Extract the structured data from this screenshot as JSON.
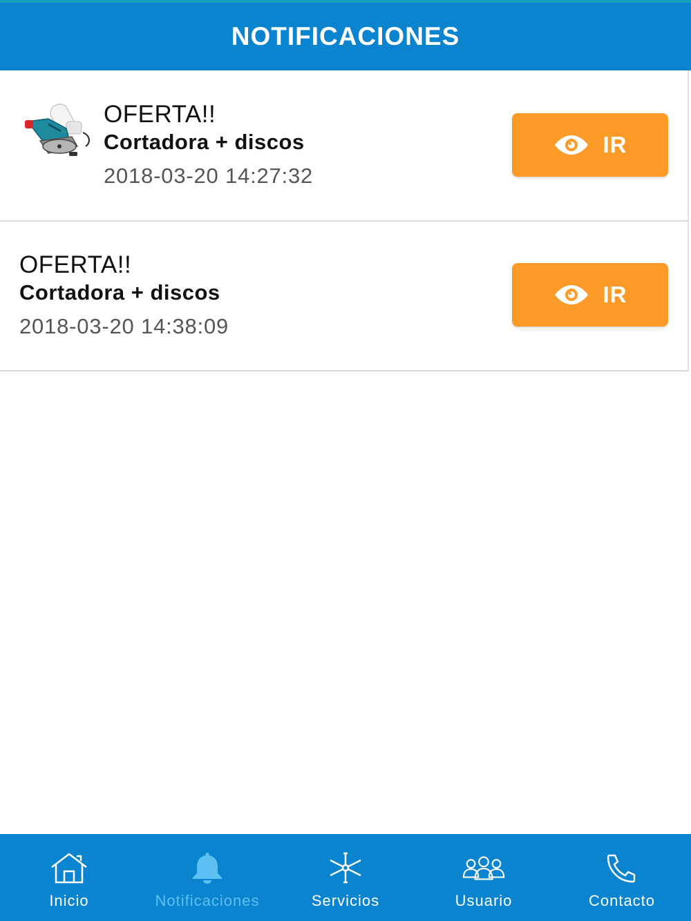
{
  "header": {
    "title": "NOTIFICACIONES"
  },
  "notifications": [
    {
      "title": "OFERTA!!",
      "subtitle": "Cortadora + discos",
      "date": "2018-03-20 14:27:32",
      "button_label": "IR",
      "button_icon": "eye-icon",
      "has_image": true,
      "image": "circular-saw-product-photo"
    },
    {
      "title": "OFERTA!!",
      "subtitle": "Cortadora + discos",
      "date": "2018-03-20 14:38:09",
      "button_label": "IR",
      "button_icon": "eye-icon",
      "has_image": false
    }
  ],
  "bottom_nav": {
    "active": "Notificaciones",
    "items": [
      {
        "label": "Inicio",
        "icon": "home-icon"
      },
      {
        "label": "Notificaciones",
        "icon": "bell-icon"
      },
      {
        "label": "Servicios",
        "icon": "asterisk-icon"
      },
      {
        "label": "Usuario",
        "icon": "users-icon"
      },
      {
        "label": "Contacto",
        "icon": "phone-icon"
      }
    ]
  },
  "colors": {
    "primary": "#0a84cf",
    "accent_button": "#fb9a27",
    "active_nav": "#5cc0f2",
    "header_top_strip": "#14a3b8"
  }
}
